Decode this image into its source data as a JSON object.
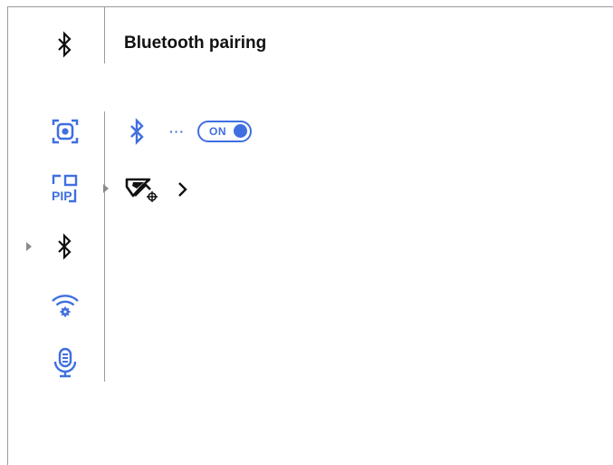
{
  "header": {
    "icon": "bluetooth-icon",
    "title": "Bluetooth pairing"
  },
  "sidebar": {
    "items": [
      {
        "icon": "camera-capture-icon",
        "active": false
      },
      {
        "icon": "pip-icon",
        "label": "PIP",
        "active": false
      },
      {
        "icon": "bluetooth-icon",
        "active": true
      },
      {
        "icon": "wifi-settings-icon",
        "active": false
      },
      {
        "icon": "microphone-icon",
        "active": false
      }
    ]
  },
  "content": {
    "bluetooth_row": {
      "icon": "bluetooth-icon",
      "connection_indicator": "···",
      "toggle_label": "ON",
      "toggle_state": true
    },
    "device_row": {
      "icon": "scope-device-icon",
      "chevron": "›"
    }
  },
  "colors": {
    "accent": "#3f6fe0",
    "text": "#111111",
    "divider": "#9a9a9a",
    "pointer": "#8a8a8a"
  }
}
